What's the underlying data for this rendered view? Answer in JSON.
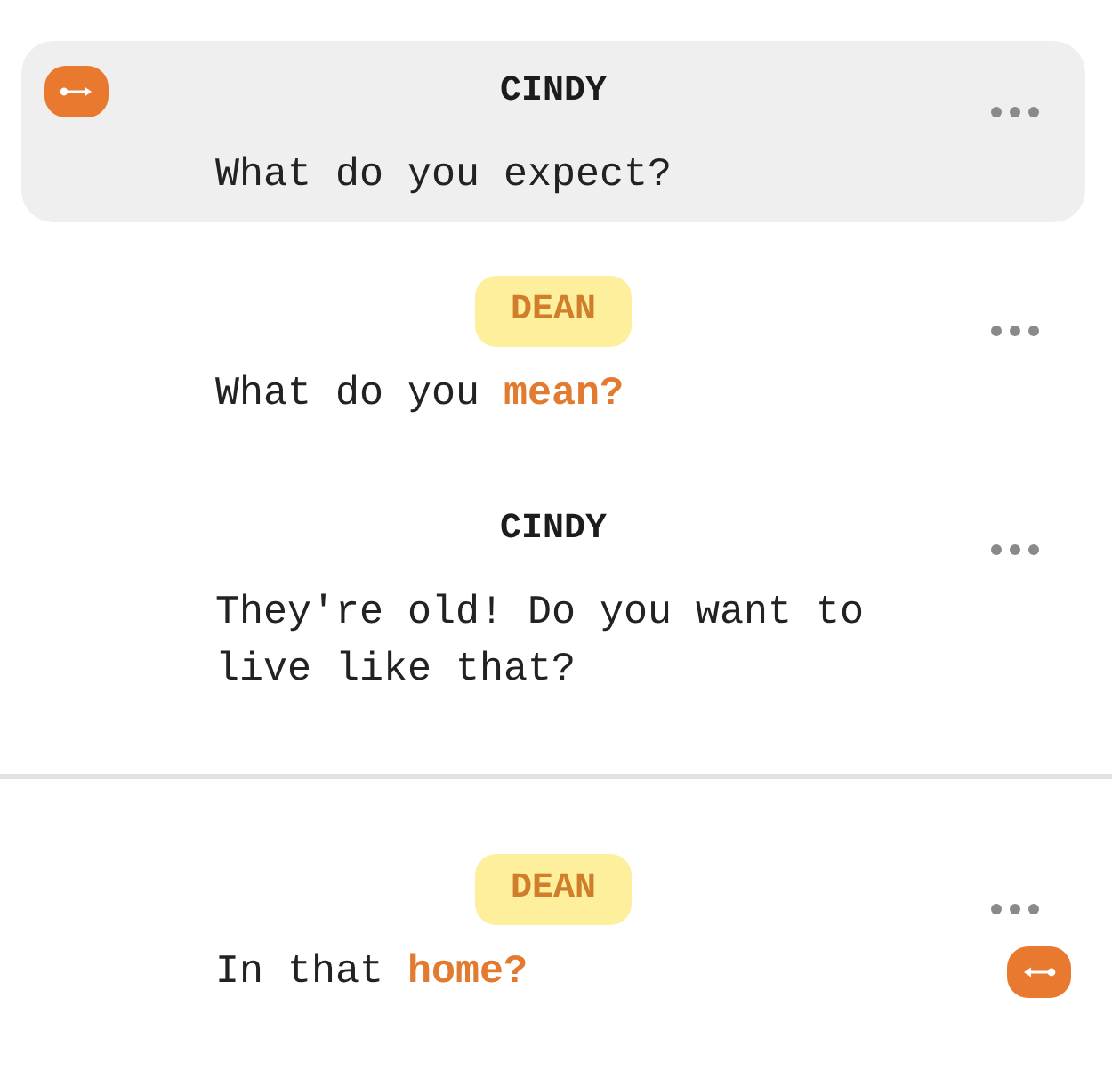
{
  "script": [
    {
      "kind": "dialogue",
      "selected": true,
      "selection_start": true,
      "selection_end": false,
      "character": "CINDY",
      "highlighted": false,
      "line": "What do you expect?"
    },
    {
      "kind": "dialogue",
      "selected": false,
      "selection_start": false,
      "selection_end": false,
      "character": "DEAN",
      "highlighted": true,
      "line": "What do you **mean?**"
    },
    {
      "kind": "dialogue",
      "selected": false,
      "selection_start": false,
      "selection_end": false,
      "character": "CINDY",
      "highlighted": false,
      "line": "They're old! Do you want to live like that?"
    },
    {
      "kind": "page_break"
    },
    {
      "kind": "dialogue",
      "selected": false,
      "selection_start": false,
      "selection_end": true,
      "character": "DEAN",
      "highlighted": true,
      "line": "In that **home?**"
    }
  ]
}
